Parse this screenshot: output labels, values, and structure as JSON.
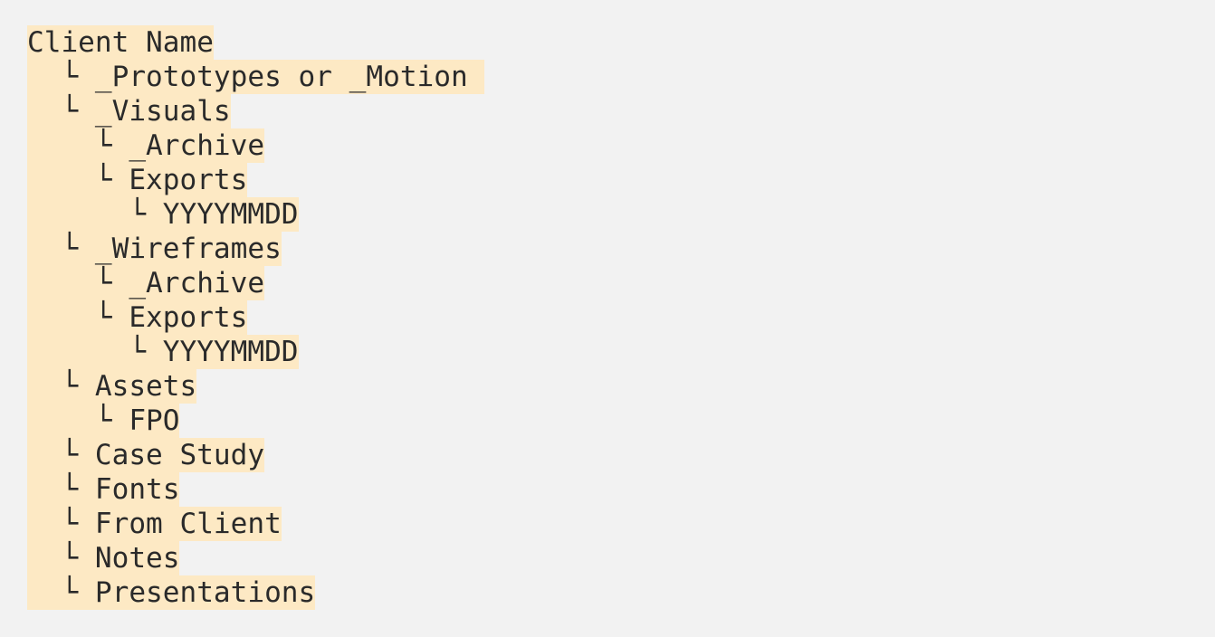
{
  "tree": {
    "lines": [
      "Client Name",
      "  └ _Prototypes or _Motion ",
      "  └ _Visuals",
      "    └ _Archive",
      "    └ Exports",
      "      └ YYYYMMDD",
      "  └ _Wireframes",
      "    └ _Archive",
      "    └ Exports",
      "      └ YYYYMMDD",
      "  └ Assets",
      "    └ FPO",
      "  └ Case Study",
      "  └ Fonts",
      "  └ From Client",
      "  └ Notes",
      "  └ Presentations"
    ]
  },
  "colors": {
    "background": "#f2f2f2",
    "highlight": "#fde9c4",
    "text": "#2a2a2a"
  }
}
